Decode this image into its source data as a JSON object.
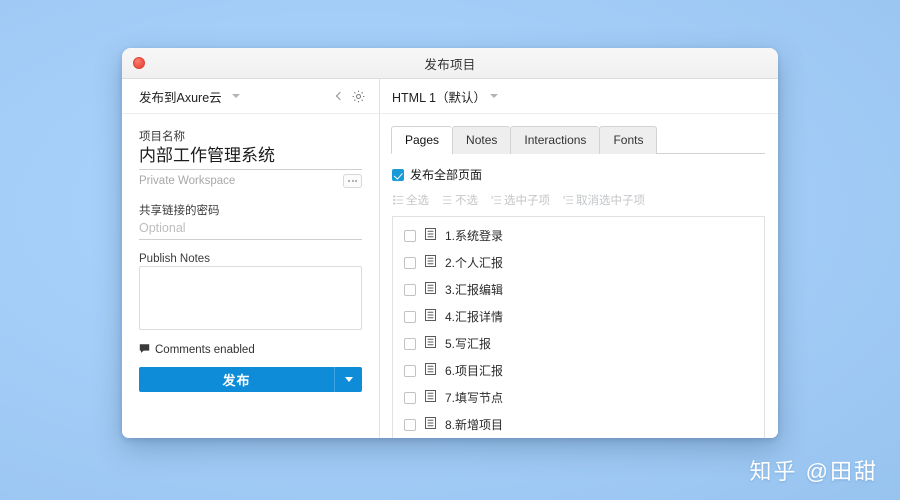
{
  "desktop": {
    "background_color": "#a4cef8",
    "watermark": "知乎 @田甜"
  },
  "window": {
    "title": "发布项目",
    "close_button_color": "#ea4f41"
  },
  "left_panel": {
    "target": {
      "label": "发布到Axure云",
      "dropdown_icon": "chevron-down-icon",
      "back_icon": "chevron-left-icon",
      "settings_icon": "gear-icon"
    },
    "project_name": {
      "label": "项目名称",
      "value": "内部工作管理系统",
      "placeholder": "项目名称"
    },
    "workspace": {
      "name": "Private Workspace",
      "more_button": "..."
    },
    "password": {
      "label": "共享链接的密码",
      "value": "",
      "placeholder": "Optional"
    },
    "publish_notes": {
      "label": "Publish Notes",
      "value": "",
      "placeholder": ""
    },
    "comments": {
      "label": "Comments enabled",
      "icon": "comment-icon"
    },
    "publish_button": {
      "label": "发布",
      "color": "#0e8cd8",
      "dropdown_icon": "caret-down-icon"
    }
  },
  "right_panel": {
    "config": {
      "name": "HTML 1（默认）",
      "dropdown_icon": "chevron-down-icon"
    },
    "tabs": [
      {
        "label": "Pages",
        "active": true
      },
      {
        "label": "Notes",
        "active": false
      },
      {
        "label": "Interactions",
        "active": false
      },
      {
        "label": "Fonts",
        "active": false
      }
    ],
    "publish_all": {
      "label": "发布全部页面",
      "checked": true,
      "checkbox_color": "#1b9ad8"
    },
    "bulk_actions": [
      {
        "label": "全选",
        "icon": "select-all-icon",
        "disabled": true
      },
      {
        "label": "不选",
        "icon": "deselect-all-icon",
        "disabled": true
      },
      {
        "label": "选中子项",
        "icon": "select-children-icon",
        "disabled": true
      },
      {
        "label": "取消选中子项",
        "icon": "deselect-children-icon",
        "disabled": true
      }
    ],
    "pages": [
      {
        "label": "1.系统登录",
        "checked": false,
        "icon": "page-icon"
      },
      {
        "label": "2.个人汇报",
        "checked": false,
        "icon": "page-icon"
      },
      {
        "label": "3.汇报编辑",
        "checked": false,
        "icon": "page-icon"
      },
      {
        "label": "4.汇报详情",
        "checked": false,
        "icon": "page-icon"
      },
      {
        "label": "5.写汇报",
        "checked": false,
        "icon": "page-icon"
      },
      {
        "label": "6.项目汇报",
        "checked": false,
        "icon": "page-icon"
      },
      {
        "label": "7.填写节点",
        "checked": false,
        "icon": "page-icon"
      },
      {
        "label": "8.新增项目",
        "checked": false,
        "icon": "page-icon"
      }
    ]
  }
}
